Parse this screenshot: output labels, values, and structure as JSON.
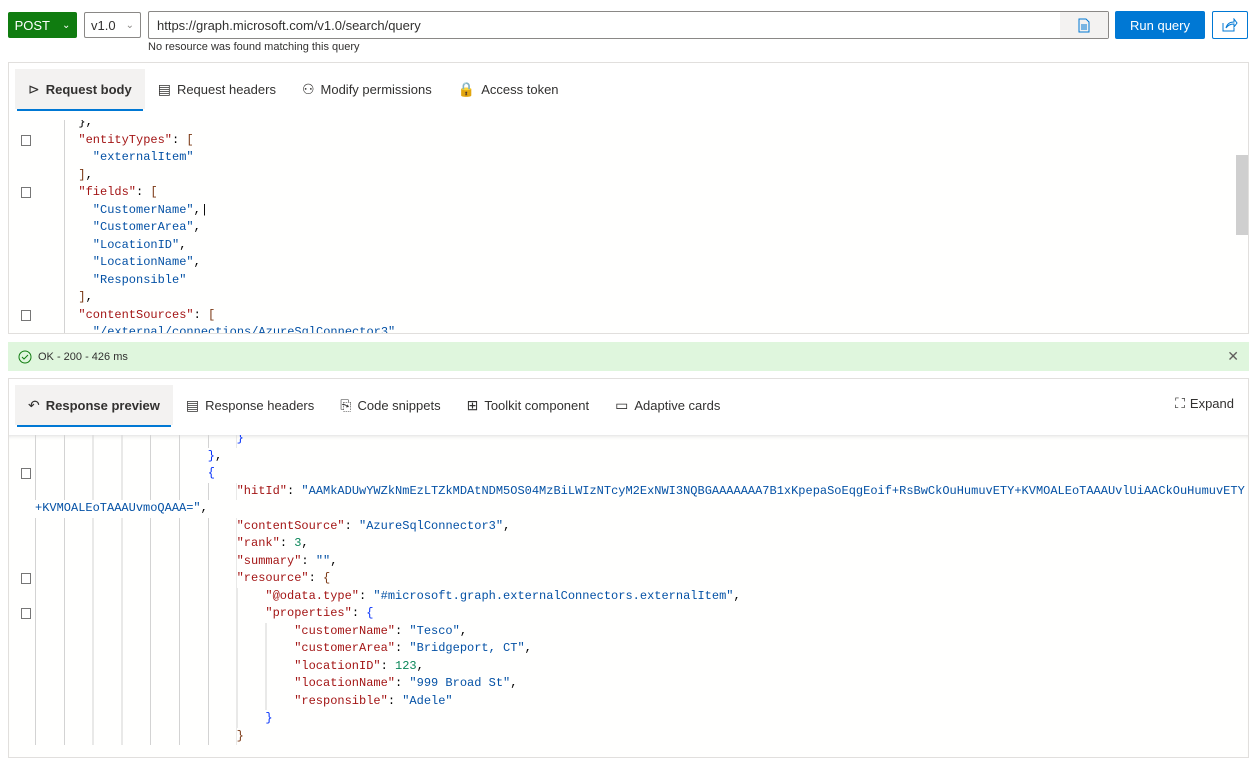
{
  "toolbar": {
    "method": "POST",
    "version": "v1.0",
    "url": "https://graph.microsoft.com/v1.0/search/query",
    "hint": "No resource was found matching this query",
    "run_label": "Run query",
    "docs_icon": "document-icon",
    "share_icon": "share-icon"
  },
  "request": {
    "tabs": [
      {
        "label": "Request body",
        "icon": "send-icon",
        "glyph": "⊳"
      },
      {
        "label": "Request headers",
        "icon": "headers-icon",
        "glyph": "▤"
      },
      {
        "label": "Modify permissions",
        "icon": "permissions-icon",
        "glyph": "⚇"
      },
      {
        "label": "Access token",
        "icon": "lock-icon",
        "glyph": "🔒"
      }
    ],
    "lines": [
      {
        "i": 1,
        "t": [
          [
            "p",
            "},"
          ]
        ]
      },
      {
        "i": 1,
        "f": 1,
        "t": [
          [
            "k",
            "\"entityTypes\""
          ],
          [
            "p",
            ": "
          ],
          [
            "b",
            "["
          ]
        ]
      },
      {
        "i": 2,
        "t": [
          [
            "s",
            "\"externalItem\""
          ]
        ]
      },
      {
        "i": 1,
        "t": [
          [
            "b",
            "]"
          ],
          [
            "p",
            ","
          ]
        ]
      },
      {
        "i": 1,
        "f": 1,
        "t": [
          [
            "k",
            "\"fields\""
          ],
          [
            "p",
            ": "
          ],
          [
            "b",
            "["
          ]
        ]
      },
      {
        "i": 2,
        "t": [
          [
            "s",
            "\"CustomerName\""
          ],
          [
            "p",
            ",|"
          ]
        ]
      },
      {
        "i": 2,
        "t": [
          [
            "s",
            "\"CustomerArea\""
          ],
          [
            "p",
            ","
          ]
        ]
      },
      {
        "i": 2,
        "t": [
          [
            "s",
            "\"LocationID\""
          ],
          [
            "p",
            ","
          ]
        ]
      },
      {
        "i": 2,
        "t": [
          [
            "s",
            "\"LocationName\""
          ],
          [
            "p",
            ","
          ]
        ]
      },
      {
        "i": 2,
        "t": [
          [
            "s",
            "\"Responsible\""
          ]
        ]
      },
      {
        "i": 1,
        "t": [
          [
            "b",
            "]"
          ],
          [
            "p",
            ","
          ]
        ]
      },
      {
        "i": 1,
        "f": 1,
        "t": [
          [
            "k",
            "\"contentSources\""
          ],
          [
            "p",
            ": "
          ],
          [
            "b",
            "["
          ]
        ]
      },
      {
        "i": 2,
        "t": [
          [
            "s",
            "\"/external/connections/AzureSqlConnector3\""
          ]
        ]
      }
    ]
  },
  "status": {
    "text": "OK - 200 - 426 ms",
    "icon": "check-circle-icon"
  },
  "response": {
    "tabs": [
      {
        "label": "Response preview",
        "icon": "undo-icon",
        "glyph": "↶"
      },
      {
        "label": "Response headers",
        "icon": "headers-icon",
        "glyph": "▤"
      },
      {
        "label": "Code snippets",
        "icon": "code-snippets-icon",
        "glyph": "⎘"
      },
      {
        "label": "Toolkit component",
        "icon": "toolkit-icon",
        "glyph": "⊞"
      },
      {
        "label": "Adaptive cards",
        "icon": "card-icon",
        "glyph": "▭"
      }
    ],
    "expand_label": "Expand",
    "lines": [
      {
        "i": 7,
        "t": [
          [
            "c",
            "}"
          ]
        ]
      },
      {
        "i": 6,
        "t": [
          [
            "c",
            "}"
          ],
          [
            "p",
            ","
          ]
        ]
      },
      {
        "i": 6,
        "f": 1,
        "t": [
          [
            "c",
            "{"
          ]
        ]
      },
      {
        "i": 7,
        "t": [
          [
            "k",
            "\"hitId\""
          ],
          [
            "p",
            ": "
          ],
          [
            "s",
            "\"AAMkADUwYWZkNmEzLTZkMDAtNDM5OS04MzBiLWIzNTcyM2ExNWI3NQBGAAAAAAA7B1xKpepaSoEqgEoif+RsBwCkOuHumuvETY+KVMOALEoTAAAUvlUiAACkOuHumuvETY"
          ]
        ]
      },
      {
        "i": 0,
        "t": [
          [
            "s",
            "+KVMOALEoTAAAUvmoQAAA=\""
          ],
          [
            "p",
            ","
          ]
        ]
      },
      {
        "i": 7,
        "t": [
          [
            "k",
            "\"contentSource\""
          ],
          [
            "p",
            ": "
          ],
          [
            "s",
            "\"AzureSqlConnector3\""
          ],
          [
            "p",
            ","
          ]
        ]
      },
      {
        "i": 7,
        "t": [
          [
            "k",
            "\"rank\""
          ],
          [
            "p",
            ": "
          ],
          [
            "n",
            "3"
          ],
          [
            "p",
            ","
          ]
        ]
      },
      {
        "i": 7,
        "t": [
          [
            "k",
            "\"summary\""
          ],
          [
            "p",
            ": "
          ],
          [
            "s",
            "\"\""
          ],
          [
            "p",
            ","
          ]
        ]
      },
      {
        "i": 7,
        "f": 1,
        "t": [
          [
            "k",
            "\"resource\""
          ],
          [
            "p",
            ": "
          ],
          [
            "b",
            "{"
          ]
        ]
      },
      {
        "i": 8,
        "t": [
          [
            "k",
            "\"@odata.type\""
          ],
          [
            "p",
            ": "
          ],
          [
            "s",
            "\"#microsoft.graph.externalConnectors.externalItem\""
          ],
          [
            "p",
            ","
          ]
        ]
      },
      {
        "i": 8,
        "f": 1,
        "t": [
          [
            "k",
            "\"properties\""
          ],
          [
            "p",
            ": "
          ],
          [
            "c",
            "{"
          ]
        ]
      },
      {
        "i": 9,
        "t": [
          [
            "k",
            "\"customerName\""
          ],
          [
            "p",
            ": "
          ],
          [
            "s",
            "\"Tesco\""
          ],
          [
            "p",
            ","
          ]
        ]
      },
      {
        "i": 9,
        "t": [
          [
            "k",
            "\"customerArea\""
          ],
          [
            "p",
            ": "
          ],
          [
            "s",
            "\"Bridgeport, CT\""
          ],
          [
            "p",
            ","
          ]
        ]
      },
      {
        "i": 9,
        "t": [
          [
            "k",
            "\"locationID\""
          ],
          [
            "p",
            ": "
          ],
          [
            "n",
            "123"
          ],
          [
            "p",
            ","
          ]
        ]
      },
      {
        "i": 9,
        "t": [
          [
            "k",
            "\"locationName\""
          ],
          [
            "p",
            ": "
          ],
          [
            "s",
            "\"999 Broad St\""
          ],
          [
            "p",
            ","
          ]
        ]
      },
      {
        "i": 9,
        "t": [
          [
            "k",
            "\"responsible\""
          ],
          [
            "p",
            ": "
          ],
          [
            "s",
            "\"Adele\""
          ]
        ]
      },
      {
        "i": 8,
        "t": [
          [
            "c",
            "}"
          ]
        ]
      },
      {
        "i": 7,
        "t": [
          [
            "b",
            "}"
          ]
        ]
      }
    ]
  }
}
